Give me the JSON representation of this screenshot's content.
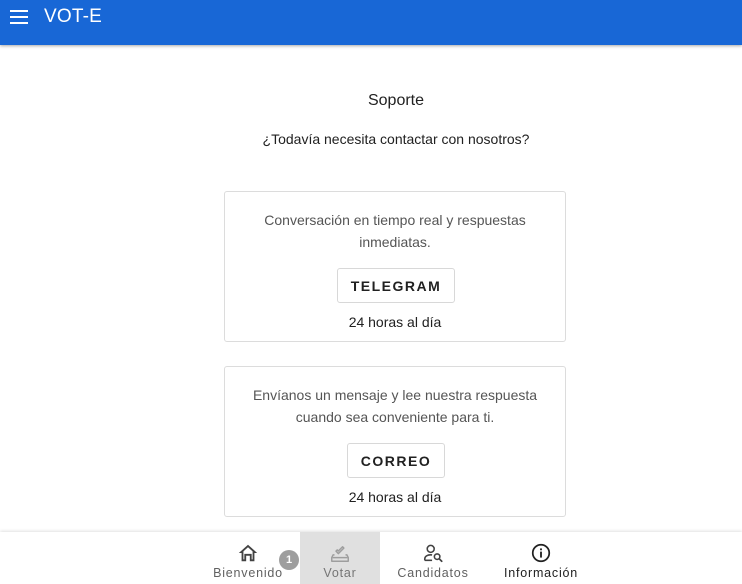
{
  "app": {
    "title": "VOT-E",
    "brand_color": "#1867d6"
  },
  "main": {
    "title": "Soporte",
    "subtitle": "¿Todavía necesita contactar con nosotros?",
    "cards": [
      {
        "description": "Conversación en tiempo real y respuestas inmediatas.",
        "button_label": "TELEGRAM",
        "hours": "24 horas al día"
      },
      {
        "description": "Envíanos un mensaje y lee nuestra respuesta cuando sea conveniente para ti.",
        "button_label": "CORREO",
        "hours": "24 horas al día"
      }
    ]
  },
  "bottom_nav": {
    "items": [
      {
        "label": "Bienvenido",
        "icon": "home-icon",
        "active": false
      },
      {
        "label": "Votar",
        "icon": "ballot-icon",
        "active": true
      },
      {
        "label": "Candidatos",
        "icon": "person-search-icon",
        "active": false
      },
      {
        "label": "Información",
        "icon": "info-icon",
        "active": false
      }
    ],
    "badge": "1"
  }
}
